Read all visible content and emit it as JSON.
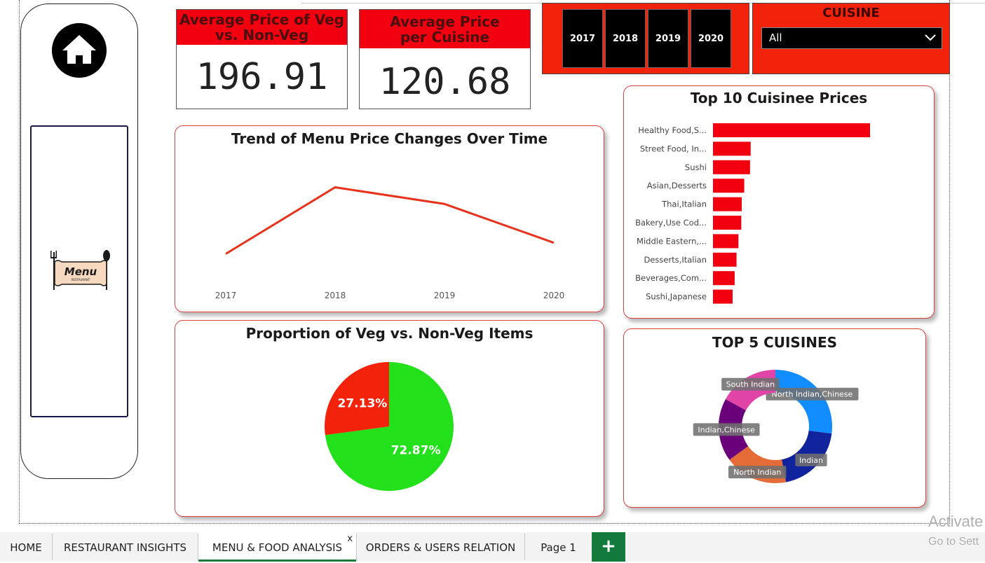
{
  "kpis": {
    "veg_nonveg": {
      "title": "Average Price of Veg vs. Non-Veg",
      "value": "196.91"
    },
    "per_cuisine": {
      "title": "Average Price per Cuisine",
      "value": "120.68"
    }
  },
  "year_slicer": {
    "years": [
      "2017",
      "2018",
      "2019",
      "2020"
    ]
  },
  "cuisine_slicer": {
    "title": "CUISINE",
    "selected": "All"
  },
  "sidebar": {
    "menu_logo_text": "Menu",
    "menu_logo_subtext": "RESTAURANT"
  },
  "chart_data": [
    {
      "type": "line",
      "title": "Trend of Menu Price Changes Over Time",
      "x": [
        "2017",
        "2018",
        "2019",
        "2020"
      ],
      "series": [
        {
          "values": [
            110,
            170,
            155,
            120
          ]
        }
      ],
      "ylim": [
        80,
        200
      ],
      "grid": false,
      "color": "#e8321c"
    },
    {
      "type": "bar",
      "orientation": "horizontal",
      "title": "Top 10 Cuisinee Prices",
      "categories": [
        "Healthy Food,S...",
        "Street Food, In...",
        "Sushi",
        "Asian,Desserts",
        "Thai,Italian",
        "Bakery,Use Cod...",
        "Middle Eastern,...",
        "Desserts,Italian",
        "Beverages,Com...",
        "Sushi,Japanese"
      ],
      "values": [
        1000,
        240,
        236,
        199,
        183,
        180,
        162,
        150,
        138,
        125
      ],
      "xlim": [
        0,
        1000
      ],
      "color": "#f2000f"
    },
    {
      "type": "pie",
      "title": "Proportion of Veg vs. Non-Veg Items",
      "slices": [
        {
          "label": "72.87%",
          "value": 72.87,
          "color": "#22e01a"
        },
        {
          "label": "27.13%",
          "value": 27.13,
          "color": "#f2230a"
        }
      ]
    },
    {
      "type": "pie",
      "variant": "donut",
      "title": "TOP 5 CUISINES",
      "slices": [
        {
          "label": "North Indian,Chinese",
          "value": 27,
          "color": "#118dff"
        },
        {
          "label": "Indian",
          "value": 20,
          "color": "#12239e"
        },
        {
          "label": "North Indian",
          "value": 18,
          "color": "#e66c37"
        },
        {
          "label": "Indian,Chinese",
          "value": 18,
          "color": "#6b007b"
        },
        {
          "label": "South Indian",
          "value": 17,
          "color": "#e044a7"
        }
      ]
    }
  ],
  "tabs": [
    {
      "label": "HOME"
    },
    {
      "label": "RESTAURANT INSIGHTS"
    },
    {
      "label": "MENU & FOOD ANALYSIS"
    },
    {
      "label": "ORDERS & USERS RELATION"
    },
    {
      "label": "Page 1"
    }
  ],
  "tab_close_label": "x",
  "add_tab_label": "+",
  "watermark": {
    "line1": "Activate",
    "line2": "Go to Sett"
  },
  "colors": {
    "accent_red": "#f2000f",
    "slicer_red": "#f2230a",
    "tab_active": "#1e7a3a"
  }
}
